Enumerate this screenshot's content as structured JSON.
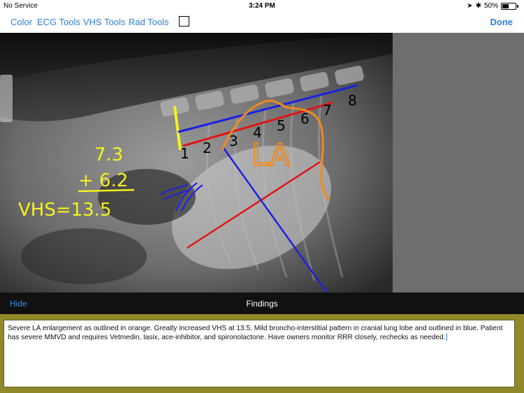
{
  "status": {
    "carrier": "No Service",
    "time": "3:24 PM",
    "battery": "50%",
    "battery_level": 0.5
  },
  "toolbar": {
    "color": "Color",
    "ecg_tools": "ECG Tools",
    "vhs_tools": "VHS Tools",
    "rad_tools": "Rad Tools",
    "done": "Done"
  },
  "annotations": {
    "vertebra_numbers": [
      "1",
      "2",
      "3",
      "4",
      "5",
      "6",
      "7",
      "8"
    ],
    "la_label": "LA",
    "calc_top": "7.3",
    "calc_add": "+ 6.2",
    "vhs_result": "VHS=13.5"
  },
  "colors": {
    "accent": "#2f7ed8",
    "orange": "#f08a1e",
    "yellow": "#f5f21e",
    "blue": "#1a22e0",
    "red": "#e01515",
    "frame": "#918a2b"
  },
  "findings": {
    "hide_label": "Hide",
    "title": "Findings",
    "text": "Severe LA enlargement as outlined in orange. Greatly increased VHS at 13.5. Mild broncho-interstitial pattern in cranial lung lobe and outlined in blue. Patient has severe MMVD and requires Vetmedin, lasix, ace-inhibitor, and spironolactone. Have owners monitor RRR closely, rechecks as needed."
  }
}
